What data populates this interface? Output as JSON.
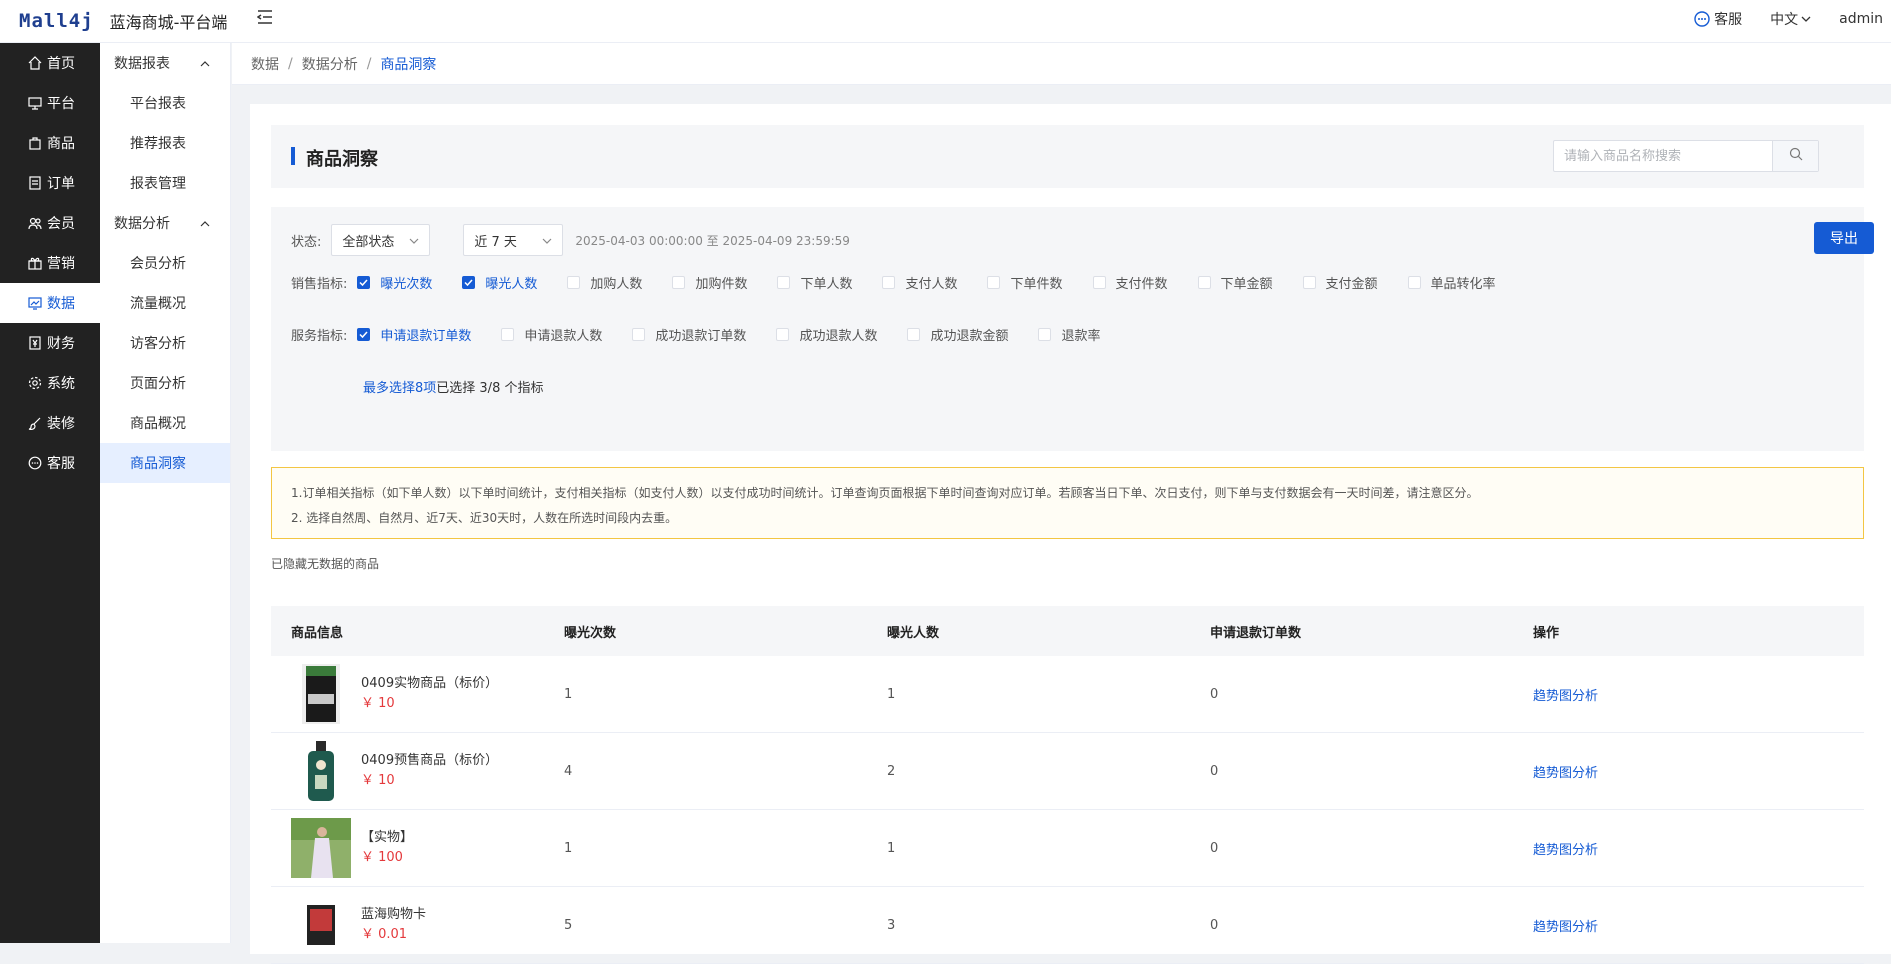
{
  "header": {
    "logo": "Mall4j",
    "title": "蓝海商城-平台端",
    "service_label": "客服",
    "lang_label": "中文",
    "user_label": "admin"
  },
  "sidebar": {
    "items": [
      {
        "label": "首页",
        "icon": "home-icon"
      },
      {
        "label": "平台",
        "icon": "monitor-icon"
      },
      {
        "label": "商品",
        "icon": "bag-icon"
      },
      {
        "label": "订单",
        "icon": "document-icon"
      },
      {
        "label": "会员",
        "icon": "users-icon"
      },
      {
        "label": "营销",
        "icon": "gift-icon"
      },
      {
        "label": "数据",
        "icon": "chart-icon"
      },
      {
        "label": "财务",
        "icon": "finance-icon"
      },
      {
        "label": "系统",
        "icon": "gear-icon"
      },
      {
        "label": "装修",
        "icon": "brush-icon"
      },
      {
        "label": "客服",
        "icon": "chat-icon"
      }
    ]
  },
  "subnav": {
    "group1": "数据报表",
    "group1_items": [
      "平台报表",
      "推荐报表",
      "报表管理"
    ],
    "group2": "数据分析",
    "group2_items": [
      "会员分析",
      "流量概况",
      "访客分析",
      "页面分析",
      "商品概况",
      "商品洞察"
    ]
  },
  "breadcrumb": [
    "数据",
    "数据分析",
    "商品洞察"
  ],
  "page": {
    "title": "商品洞察",
    "search_placeholder": "请输入商品名称搜索",
    "export_label": "导出"
  },
  "filters": {
    "status_label": "状态:",
    "status_value": "全部状态",
    "period_value": "近 7 天",
    "date_range": "2025-04-03 00:00:00 至 2025-04-09 23:59:59",
    "sales_label": "销售指标:",
    "sales_metrics": [
      {
        "label": "曝光次数",
        "checked": true
      },
      {
        "label": "曝光人数",
        "checked": true
      },
      {
        "label": "加购人数",
        "checked": false
      },
      {
        "label": "加购件数",
        "checked": false
      },
      {
        "label": "下单人数",
        "checked": false
      },
      {
        "label": "支付人数",
        "checked": false
      },
      {
        "label": "下单件数",
        "checked": false
      },
      {
        "label": "支付件数",
        "checked": false
      },
      {
        "label": "下单金额",
        "checked": false
      },
      {
        "label": "支付金额",
        "checked": false
      },
      {
        "label": "单品转化率",
        "checked": false
      }
    ],
    "service_label": "服务指标:",
    "service_metrics": [
      {
        "label": "申请退款订单数",
        "checked": true
      },
      {
        "label": "申请退款人数",
        "checked": false
      },
      {
        "label": "成功退款订单数",
        "checked": false
      },
      {
        "label": "成功退款人数",
        "checked": false
      },
      {
        "label": "成功退款金额",
        "checked": false
      },
      {
        "label": "退款率",
        "checked": false
      }
    ],
    "max_select": "最多选择8项",
    "selected_count": "已选择 3/8 个指标"
  },
  "notice": {
    "line1": "1.订单相关指标（如下单人数）以下单时间统计，支付相关指标（如支付人数）以支付成功时间统计。订单查询页面根据下单时间查询对应订单。若顾客当日下单、次日支付，则下单与支付数据会有一天时间差，请注意区分。",
    "line2": "2. 选择自然周、自然月、近7天、近30天时，人数在所选时间段内去重。"
  },
  "hidden_tip": "已隐藏无数据的商品",
  "table": {
    "headers": [
      "商品信息",
      "曝光次数",
      "曝光人数",
      "申请退款订单数",
      "操作"
    ],
    "rows": [
      {
        "name": "0409实物商品（标价）",
        "price": "￥ 10",
        "exposure": "1",
        "visitors": "1",
        "refund_orders": "0",
        "action": "趋势图分析"
      },
      {
        "name": "0409预售商品（标价）",
        "price": "￥ 10",
        "exposure": "4",
        "visitors": "2",
        "refund_orders": "0",
        "action": "趋势图分析"
      },
      {
        "name": "【实物】",
        "price": "￥ 100",
        "exposure": "1",
        "visitors": "1",
        "refund_orders": "0",
        "action": "趋势图分析"
      },
      {
        "name": "蓝海购物卡",
        "price": "￥ 0.01",
        "exposure": "5",
        "visitors": "3",
        "refund_orders": "0",
        "action": "趋势图分析"
      }
    ]
  },
  "colors": {
    "accent": "#155bd4",
    "sidebar_bg": "#222222",
    "price": "#e4393c",
    "notice_border": "#f3c643"
  }
}
